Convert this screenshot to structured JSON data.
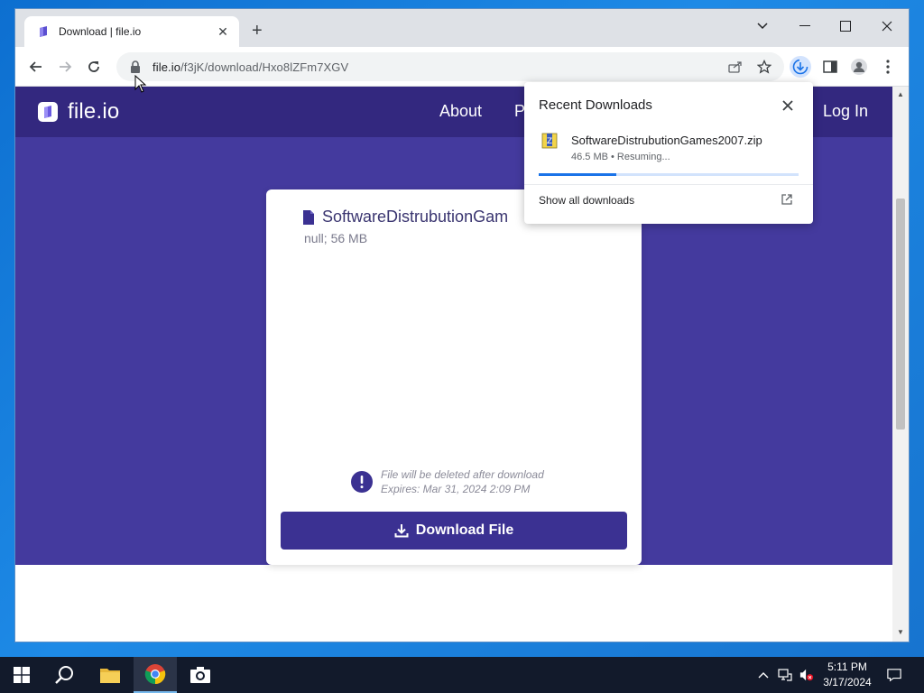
{
  "browser": {
    "tab_title": "Download | file.io",
    "url_host": "file.io",
    "url_path": "/f3jK/download/Hxo8lZFm7XGV"
  },
  "site": {
    "logo_text": "file.io",
    "nav": {
      "about": "About",
      "partial": "P",
      "login": "Log In"
    }
  },
  "card": {
    "file_name": "SoftwareDistrubutionGam",
    "file_meta": "null; 56 MB",
    "notice_line1": "File will be deleted after download",
    "notice_line2": "Expires: Mar 31, 2024 2:09 PM",
    "download_label": "Download File"
  },
  "downloads": {
    "title": "Recent Downloads",
    "item_name": "SoftwareDistrubutionGames2007.zip",
    "item_status": "46.5 MB • Resuming...",
    "progress_fraction": 0.3,
    "show_all": "Show all downloads"
  },
  "taskbar": {
    "time": "5:11 PM",
    "date": "3/17/2024"
  },
  "colors": {
    "site_header": "#33287f",
    "hero": "#443a9e",
    "button": "#3b3192",
    "progress": "#1a73e8"
  }
}
